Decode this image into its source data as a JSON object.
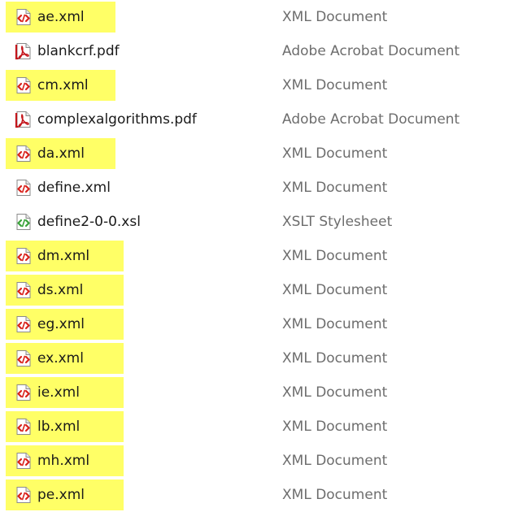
{
  "files": [
    {
      "name": "ae.xml",
      "type": "XML Document",
      "icon": "xml-icon",
      "highlighted": true
    },
    {
      "name": "blankcrf.pdf",
      "type": "Adobe Acrobat Document",
      "icon": "pdf-icon",
      "highlighted": false
    },
    {
      "name": "cm.xml",
      "type": "XML Document",
      "icon": "xml-icon",
      "highlighted": true
    },
    {
      "name": "complexalgorithms.pdf",
      "type": "Adobe Acrobat Document",
      "icon": "pdf-icon",
      "highlighted": false
    },
    {
      "name": "da.xml",
      "type": "XML Document",
      "icon": "xml-icon",
      "highlighted": true
    },
    {
      "name": "define.xml",
      "type": "XML Document",
      "icon": "xml-icon",
      "highlighted": false
    },
    {
      "name": "define2-0-0.xsl",
      "type": "XSLT Stylesheet",
      "icon": "xsl-icon",
      "highlighted": false
    },
    {
      "name": "dm.xml",
      "type": "XML Document",
      "icon": "xml-icon",
      "highlighted": true
    },
    {
      "name": "ds.xml",
      "type": "XML Document",
      "icon": "xml-icon",
      "highlighted": true
    },
    {
      "name": "eg.xml",
      "type": "XML Document",
      "icon": "xml-icon",
      "highlighted": true
    },
    {
      "name": "ex.xml",
      "type": "XML Document",
      "icon": "xml-icon",
      "highlighted": true
    },
    {
      "name": "ie.xml",
      "type": "XML Document",
      "icon": "xml-icon",
      "highlighted": true
    },
    {
      "name": "lb.xml",
      "type": "XML Document",
      "icon": "xml-icon",
      "highlighted": true
    },
    {
      "name": "mh.xml",
      "type": "XML Document",
      "icon": "xml-icon",
      "highlighted": true
    },
    {
      "name": "pe.xml",
      "type": "XML Document",
      "icon": "xml-icon",
      "highlighted": true
    }
  ],
  "colors": {
    "highlight": "#ffff66",
    "xml_accent": "#d9221c",
    "xsl_accent": "#3aa33a",
    "pdf_accent": "#c4161c",
    "type_text": "#6d6d6d"
  }
}
